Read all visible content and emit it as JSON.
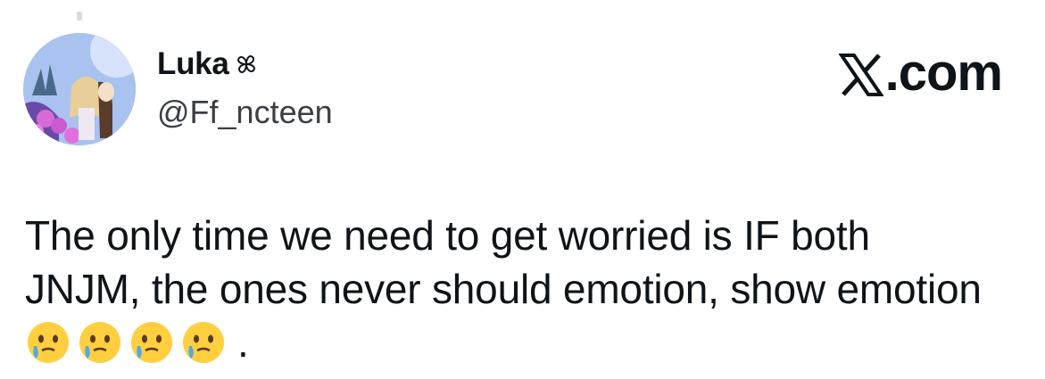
{
  "author": {
    "display_name": "Luka",
    "handle": "@Ff_ncteen",
    "name_badge_icon": "clover-outline-icon",
    "avatar_icon": "anime-avatar"
  },
  "brand": {
    "logo_icon": "x-logo-icon",
    "domain_suffix": ".com"
  },
  "tweet": {
    "line1": "The only time we need to get worried is IF  both",
    "line2": "JNJM, the ones never should emotion, show emotion",
    "emoji": [
      "face-holding-back-tears-icon",
      "face-holding-back-tears-icon",
      "face-holding-back-tears-icon",
      "face-holding-back-tears-icon"
    ],
    "end_punct": "."
  },
  "colors": {
    "text": "#0f1419",
    "secondary": "#3b3f44",
    "emoji_face": "#ffcf3f",
    "tear": "#4fa9e8"
  }
}
